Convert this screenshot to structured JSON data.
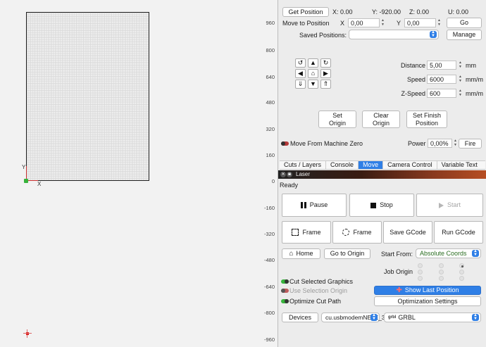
{
  "rulers": [
    "960",
    "800",
    "640",
    "480",
    "320",
    "160",
    "0",
    "-160",
    "-320",
    "-480",
    "-640",
    "-800",
    "-960"
  ],
  "canvas": {
    "axis_x": "X",
    "axis_y": "Y"
  },
  "position": {
    "get_position_label": "Get Position",
    "x": "X: 0.00",
    "y": "Y: -920.00",
    "z": "Z: 0.00",
    "u": "U: 0.00",
    "move_to_label": "Move to Position",
    "x_label": "X",
    "x_value": "0,00",
    "y_label": "Y",
    "y_value": "0,00",
    "go_label": "Go",
    "saved_label": "Saved Positions:",
    "saved_value": "",
    "manage_label": "Manage"
  },
  "jog": {
    "distance_label": "Distance",
    "distance_value": "5,00",
    "distance_unit": "mm",
    "speed_label": "Speed",
    "speed_value": "6000",
    "speed_unit": "mm/m",
    "zspeed_label": "Z-Speed",
    "zspeed_value": "600",
    "zspeed_unit": "mm/m"
  },
  "origin_buttons": {
    "set_origin": "Set\nOrigin",
    "clear_origin": "Clear\nOrigin",
    "set_finish": "Set Finish\nPosition"
  },
  "move_from_zero": "Move From Machine Zero",
  "power": {
    "label": "Power",
    "value": "0,00%",
    "fire": "Fire"
  },
  "tabs": [
    "Cuts / Layers",
    "Console",
    "Move",
    "Camera Control",
    "Variable Text"
  ],
  "active_tab": "Move",
  "laser_window": {
    "title": "Laser",
    "status": "Ready"
  },
  "controls": {
    "pause": "Pause",
    "stop": "Stop",
    "start": "Start",
    "frame1": "Frame",
    "frame2": "Frame",
    "save_gcode": "Save GCode",
    "run_gcode": "Run GCode",
    "home": "Home",
    "go_to_origin": "Go to Origin",
    "start_from_label": "Start From:",
    "start_from_value": "Absolute Coords",
    "job_origin_label": "Job Origin"
  },
  "options": {
    "cut_selected": "Cut Selected Graphics",
    "use_selection_origin": "Use Selection Origin",
    "optimize_cut_path": "Optimize Cut Path",
    "show_last_position": "Show Last Position",
    "optimization_settings": "Optimization Settings"
  },
  "devices": {
    "label": "Devices",
    "port": "cu.usbmodemNEJE_3_",
    "controller": "GRBL",
    "controller_prefix": "grbl"
  },
  "colors": {
    "accent": "#2f7fe6",
    "toggle_on": "#37b23b",
    "toggle_off": "#b53a3a"
  }
}
